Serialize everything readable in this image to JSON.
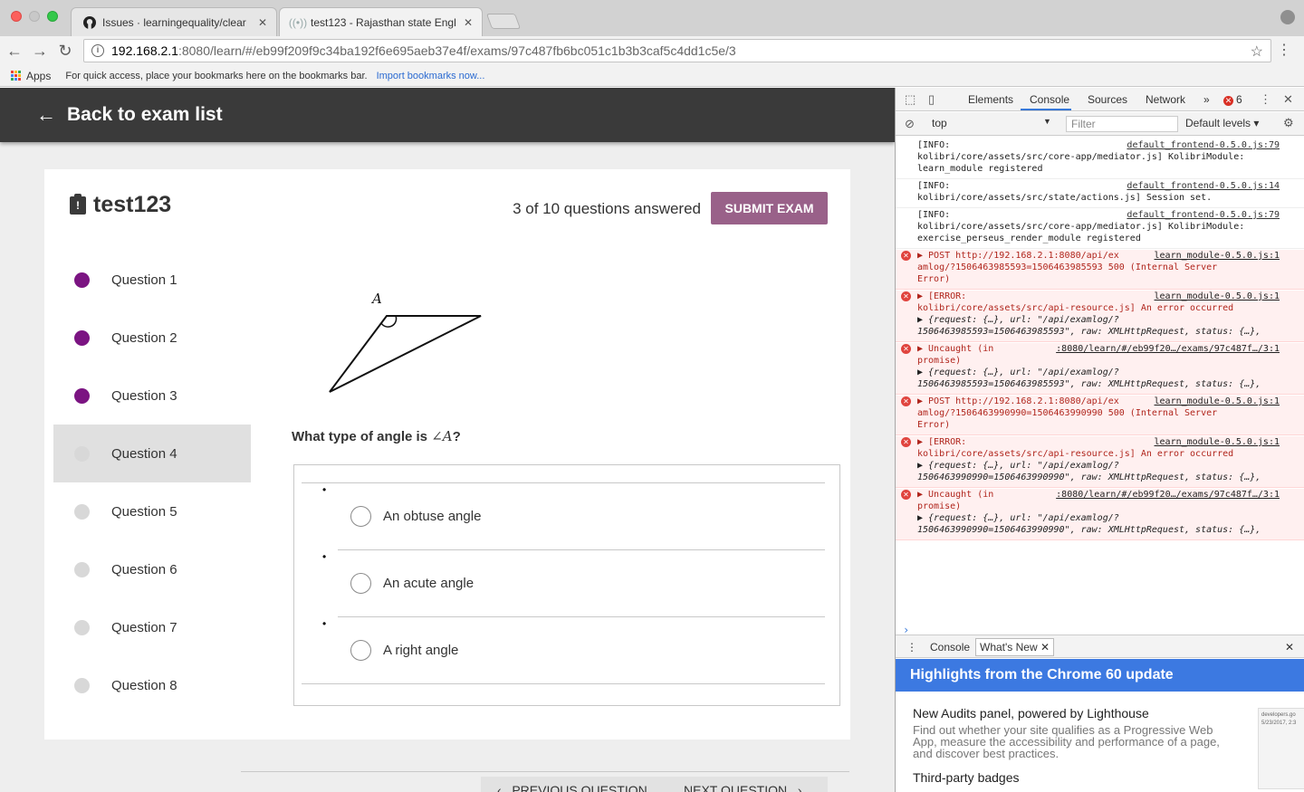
{
  "browser": {
    "tabs": [
      {
        "title": "Issues · learningequality/clear",
        "icon": "github-icon"
      },
      {
        "title": "test123 - Rajasthan state Engl",
        "icon": "kolibri-icon"
      }
    ],
    "address": {
      "host": "192.168.2.1",
      "rest": ":8080/learn/#/eb99f209f9c34ba192f6e695aeb37e4f/exams/97c487fb6bc051c1b3b3caf5c4dd1c5e/3"
    },
    "bookmarks": {
      "apps_label": "Apps",
      "note": "For quick access, place your bookmarks here on the bookmarks bar.",
      "import_link": "Import bookmarks now..."
    }
  },
  "appbar": {
    "back_label": "Back to exam list"
  },
  "exam": {
    "title": "test123",
    "progress": "3 of 10 questions answered",
    "submit_label": "SUBMIT EXAM",
    "questions": [
      {
        "label": "Question 1",
        "answered": true
      },
      {
        "label": "Question 2",
        "answered": true
      },
      {
        "label": "Question 3",
        "answered": true
      },
      {
        "label": "Question 4",
        "answered": false,
        "selected": true
      },
      {
        "label": "Question 5",
        "answered": false
      },
      {
        "label": "Question 6",
        "answered": false
      },
      {
        "label": "Question 7",
        "answered": false
      },
      {
        "label": "Question 8",
        "answered": false
      }
    ],
    "figure_label": "A",
    "prompt_before": "What type of angle is ",
    "prompt_math": "∠A",
    "prompt_after": "?",
    "answers": [
      "An obtuse angle",
      "An acute angle",
      "A right angle"
    ],
    "bullet": "•",
    "prev_label": "PREVIOUS QUESTION",
    "next_label": "NEXT QUESTION"
  },
  "colors": {
    "answered_dot": "#7b1482",
    "unanswered_dot": "#d8d8d8",
    "submit_bg": "#996189",
    "appbar_bg": "#3a3a3a"
  },
  "devtools": {
    "tabs": [
      "Elements",
      "Console",
      "Sources",
      "Network"
    ],
    "more": "»",
    "error_count": "6",
    "context": "top",
    "filter_placeholder": "Filter",
    "levels": "Default levels",
    "messages": [
      {
        "type": "info",
        "lines": [
          "[INFO:",
          "kolibri/core/assets/src/core-app/mediator.js] KolibriModule:",
          "learn_module registered"
        ],
        "src": "default_frontend-0.5.0.js:79"
      },
      {
        "type": "info",
        "lines": [
          "[INFO:",
          "kolibri/core/assets/src/state/actions.js] Session set."
        ],
        "src": "default_frontend-0.5.0.js:14"
      },
      {
        "type": "info",
        "lines": [
          "[INFO:",
          "kolibri/core/assets/src/core-app/mediator.js] KolibriModule:",
          "exercise_perseus_render_module registered"
        ],
        "src": "default_frontend-0.5.0.js:79"
      },
      {
        "type": "error",
        "lines": [
          "▶ POST http://192.168.2.1:8080/api/ex",
          "amlog/?1506463985593=1506463985593 500 (Internal Server",
          "Error)"
        ],
        "src": "learn_module-0.5.0.js:1"
      },
      {
        "type": "error",
        "lines": [
          "▶ [ERROR:",
          "kolibri/core/assets/src/api-resource.js] An error occurred",
          " ▶ {request: {…}, url: \"/api/examlog/?",
          "   1506463985593=1506463985593\", raw: XMLHttpRequest, status: {…},"
        ],
        "src": "learn_module-0.5.0.js:1"
      },
      {
        "type": "error",
        "lines": [
          "▶ Uncaught (in",
          "promise)",
          " ▶ {request: {…}, url: \"/api/examlog/?",
          "   1506463985593=1506463985593\", raw: XMLHttpRequest, status: {…},"
        ],
        "src": ":8080/learn/#/eb99f20…/exams/97c487f…/3:1"
      },
      {
        "type": "error",
        "lines": [
          "▶ POST http://192.168.2.1:8080/api/ex",
          "amlog/?1506463990990=1506463990990 500 (Internal Server",
          "Error)"
        ],
        "src": "learn_module-0.5.0.js:1"
      },
      {
        "type": "error",
        "lines": [
          "▶ [ERROR:",
          "kolibri/core/assets/src/api-resource.js] An error occurred",
          " ▶ {request: {…}, url: \"/api/examlog/?",
          "   1506463990990=1506463990990\", raw: XMLHttpRequest, status: {…},"
        ],
        "src": "learn_module-0.5.0.js:1"
      },
      {
        "type": "error",
        "lines": [
          "▶ Uncaught (in",
          "promise)",
          " ▶ {request: {…}, url: \"/api/examlog/?",
          "   1506463990990=1506463990990\", raw: XMLHttpRequest, status: {…},"
        ],
        "src": ":8080/learn/#/eb99f20…/exams/97c487f…/3:1"
      }
    ],
    "prompt_caret": "›",
    "drawer_tabs": [
      "Console",
      "What's New"
    ],
    "highlights": "Highlights from the Chrome 60 update",
    "whatsnew": [
      {
        "title": "New Audits panel, powered by Lighthouse",
        "body": "Find out whether your site qualifies as a Progressive Web App, measure the accessibility and performance of a page, and discover best practices."
      },
      {
        "title": "Third-party badges",
        "body": ""
      }
    ],
    "thumb_text": "developers.go 5/23/2017, 2:3"
  }
}
